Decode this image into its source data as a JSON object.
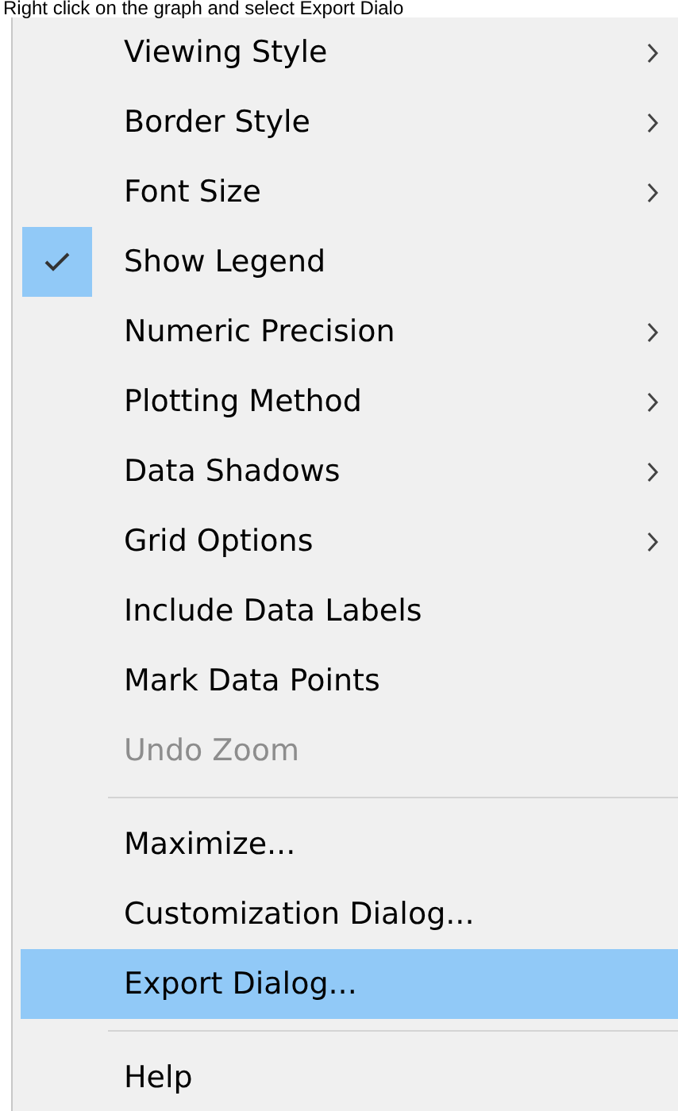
{
  "caption": "Right click on the graph and select Export Dialo",
  "menu": {
    "items": [
      {
        "kind": "item",
        "label": "Viewing Style",
        "submenu": true,
        "checked": false,
        "disabled": false,
        "selected": false
      },
      {
        "kind": "item",
        "label": "Border Style",
        "submenu": true,
        "checked": false,
        "disabled": false,
        "selected": false
      },
      {
        "kind": "item",
        "label": "Font Size",
        "submenu": true,
        "checked": false,
        "disabled": false,
        "selected": false
      },
      {
        "kind": "item",
        "label": "Show Legend",
        "submenu": false,
        "checked": true,
        "disabled": false,
        "selected": false
      },
      {
        "kind": "item",
        "label": "Numeric Precision",
        "submenu": true,
        "checked": false,
        "disabled": false,
        "selected": false
      },
      {
        "kind": "item",
        "label": "Plotting Method",
        "submenu": true,
        "checked": false,
        "disabled": false,
        "selected": false
      },
      {
        "kind": "item",
        "label": "Data Shadows",
        "submenu": true,
        "checked": false,
        "disabled": false,
        "selected": false
      },
      {
        "kind": "item",
        "label": "Grid Options",
        "submenu": true,
        "checked": false,
        "disabled": false,
        "selected": false
      },
      {
        "kind": "item",
        "label": "Include Data Labels",
        "submenu": false,
        "checked": false,
        "disabled": false,
        "selected": false
      },
      {
        "kind": "item",
        "label": "Mark Data Points",
        "submenu": false,
        "checked": false,
        "disabled": false,
        "selected": false
      },
      {
        "kind": "item",
        "label": "Undo Zoom",
        "submenu": false,
        "checked": false,
        "disabled": true,
        "selected": false
      },
      {
        "kind": "separator"
      },
      {
        "kind": "item",
        "label": "Maximize...",
        "submenu": false,
        "checked": false,
        "disabled": false,
        "selected": false
      },
      {
        "kind": "item",
        "label": "Customization Dialog...",
        "submenu": false,
        "checked": false,
        "disabled": false,
        "selected": false
      },
      {
        "kind": "item",
        "label": "Export Dialog...",
        "submenu": false,
        "checked": false,
        "disabled": false,
        "selected": true
      },
      {
        "kind": "separator"
      },
      {
        "kind": "item",
        "label": "Help",
        "submenu": false,
        "checked": false,
        "disabled": false,
        "selected": false
      }
    ]
  }
}
